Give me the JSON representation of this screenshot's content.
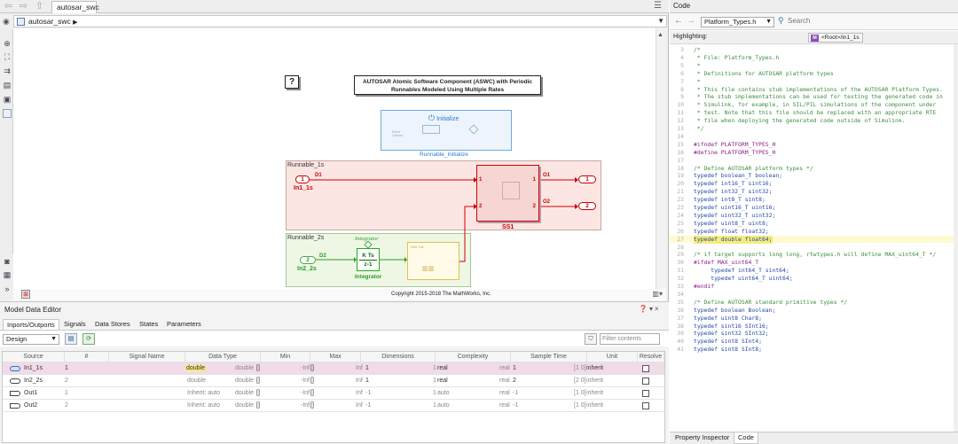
{
  "top_toolbar": {
    "model_tab": "autosar_swc"
  },
  "address": {
    "path": "autosar_swc",
    "arrow": "▶"
  },
  "canvas": {
    "help_text": "?",
    "title_line1": "AUTOSAR Atomic Software Component (ASWC) with Periodic",
    "title_line2": "Runnables Modeled Using Multiple Rates",
    "initialize_title": "Initialize",
    "initialize_inner": "Event Listener",
    "initialize_label": "Runnable_Initialize",
    "runnable_1s": "Runnable_1s",
    "runnable_2s": "Runnable_2s",
    "in1_num": "1",
    "in1_label": "In1_1s",
    "in2_num": "2",
    "in2_label": "In2_2s",
    "out1_num": "1",
    "out2_num": "2",
    "sig_d1": "D1",
    "sig_d2": "D2",
    "sig_o1": "O1",
    "sig_o2": "O2",
    "ss1_port1": "1",
    "ss1_port2": "2",
    "ss1_label": "SS1",
    "integrator_top": "Integrator",
    "integrator_line1": "K Ts",
    "integrator_line2": "z-1",
    "integrator_bottom": "Integrator",
    "ratetrans_label": "Rate Tran",
    "copyright": "Copyright 2015-2018 The MathWorks, Inc."
  },
  "mde": {
    "title": "Model Data Editor",
    "tabs": [
      "Inports/Outports",
      "Signals",
      "Data Stores",
      "States",
      "Parameters"
    ],
    "view_select": "Design",
    "filter_placeholder": "Filter contents",
    "columns": [
      "Source",
      "#",
      "Signal Name",
      "Data Type",
      "Min",
      "Max",
      "Dimensions",
      "Complexity",
      "Sample Time",
      "Unit",
      "Resolve"
    ],
    "rows": [
      {
        "source": "In1_1s",
        "num": "1",
        "signal": "",
        "dtype": "double",
        "dtype2": "double",
        "dtype3": "[]",
        "min": "-Inf",
        "min2": "[]",
        "max": "Inf",
        "dims": "1",
        "dims2": "1",
        "complexity": "real",
        "complexity2": "real",
        "st": "1",
        "st2": "[1 0]",
        "unit": "inherit"
      },
      {
        "source": "In2_2s",
        "num": "2",
        "signal": "",
        "dtype": "double",
        "dtype2": "double",
        "dtype3": "[]",
        "min": "-Inf",
        "min2": "[]",
        "max": "Inf",
        "dims": "1",
        "dims2": "1",
        "complexity": "real",
        "complexity2": "real",
        "st": "2",
        "st2": "[2 0]",
        "unit": "inherit"
      },
      {
        "source": "Out1",
        "num": "1",
        "signal": "",
        "dtype": "Inherit: auto",
        "dtype2": "double",
        "dtype3": "[]",
        "min": "-Inf",
        "min2": "[]",
        "max": "Inf",
        "dims": "-1",
        "dims2": "1",
        "complexity": "auto",
        "complexity2": "real",
        "st": "-1",
        "st2": "[1 0]",
        "unit": "inherit"
      },
      {
        "source": "Out2",
        "num": "2",
        "signal": "",
        "dtype": "Inherit: auto",
        "dtype2": "double",
        "dtype3": "[]",
        "min": "-Inf",
        "min2": "[]",
        "max": "Inf",
        "dims": "-1",
        "dims2": "1",
        "complexity": "auto",
        "complexity2": "real",
        "st": "-1",
        "st2": "[1 0]",
        "unit": "inherit"
      }
    ]
  },
  "code_panel": {
    "title": "Code",
    "file": "Platform_Types.h",
    "search_placeholder": "Search",
    "highlighting_label": "Highlighting:",
    "highlight_chip": "<Root>/In1_1s",
    "chip_icon": "M",
    "lines": [
      {
        "n": "3",
        "t": "/*"
      },
      {
        "n": "4",
        "t": " * File: Platform_Types.h"
      },
      {
        "n": "5",
        "t": " *"
      },
      {
        "n": "6",
        "t": " * Definitions for AUTOSAR platform types"
      },
      {
        "n": "7",
        "t": " *"
      },
      {
        "n": "8",
        "t": " * This file contains stub implementations of the AUTOSAR Platform Types."
      },
      {
        "n": "9",
        "t": " * The stub implementations can be used for testing the generated code in"
      },
      {
        "n": "10",
        "t": " * Simulink, for example, in SIL/PIL simulations of the component under"
      },
      {
        "n": "11",
        "t": " * test. Note that this file should be replaced with an appropriate RTE"
      },
      {
        "n": "12",
        "t": " * file when deploying the generated code outside of Simulink."
      },
      {
        "n": "13",
        "t": " */"
      },
      {
        "n": "14",
        "t": ""
      },
      {
        "n": "15",
        "t": "#ifndef PLATFORM_TYPES_H"
      },
      {
        "n": "16",
        "t": "#define PLATFORM_TYPES_H"
      },
      {
        "n": "17",
        "t": ""
      },
      {
        "n": "18",
        "t": "/* Define AUTOSAR platform types */"
      },
      {
        "n": "19",
        "t": "typedef boolean_T boolean;"
      },
      {
        "n": "20",
        "t": "typedef int16_T sint16;"
      },
      {
        "n": "21",
        "t": "typedef int32_T sint32;"
      },
      {
        "n": "22",
        "t": "typedef int8_T sint8;"
      },
      {
        "n": "23",
        "t": "typedef uint16_T uint16;"
      },
      {
        "n": "24",
        "t": "typedef uint32_T uint32;"
      },
      {
        "n": "25",
        "t": "typedef uint8_T uint8;"
      },
      {
        "n": "26",
        "t": "typedef float float32;"
      },
      {
        "n": "27",
        "t": "typedef double float64;"
      },
      {
        "n": "28",
        "t": ""
      },
      {
        "n": "29",
        "t": "/* if target supports long long, rtwtypes.h will define MAX_uint64_T */"
      },
      {
        "n": "30",
        "t": "#ifdef MAX_uint64_T"
      },
      {
        "n": "31",
        "t": "     typedef int64_T sint64;"
      },
      {
        "n": "32",
        "t": "     typedef uint64_T uint64;"
      },
      {
        "n": "33",
        "t": "#endif"
      },
      {
        "n": "34",
        "t": ""
      },
      {
        "n": "35",
        "t": "/* Define AUTOSAR standard primitive types */"
      },
      {
        "n": "36",
        "t": "typedef boolean Boolean;"
      },
      {
        "n": "37",
        "t": "typedef uint8 Char8;"
      },
      {
        "n": "38",
        "t": "typedef sint16 SInt16;"
      },
      {
        "n": "39",
        "t": "typedef sint32 SInt32;"
      },
      {
        "n": "40",
        "t": "typedef sint8 SInt4;"
      },
      {
        "n": "41",
        "t": "typedef sint8 SInt8;"
      }
    ],
    "selected_line": "27",
    "bottom_tabs": [
      "Property Inspector",
      "Code"
    ]
  },
  "colors": {
    "comment": "#3d8f3d",
    "keyword": "#8a1f8a",
    "type": "#2449a8",
    "highlight": "#f5ec7c"
  }
}
